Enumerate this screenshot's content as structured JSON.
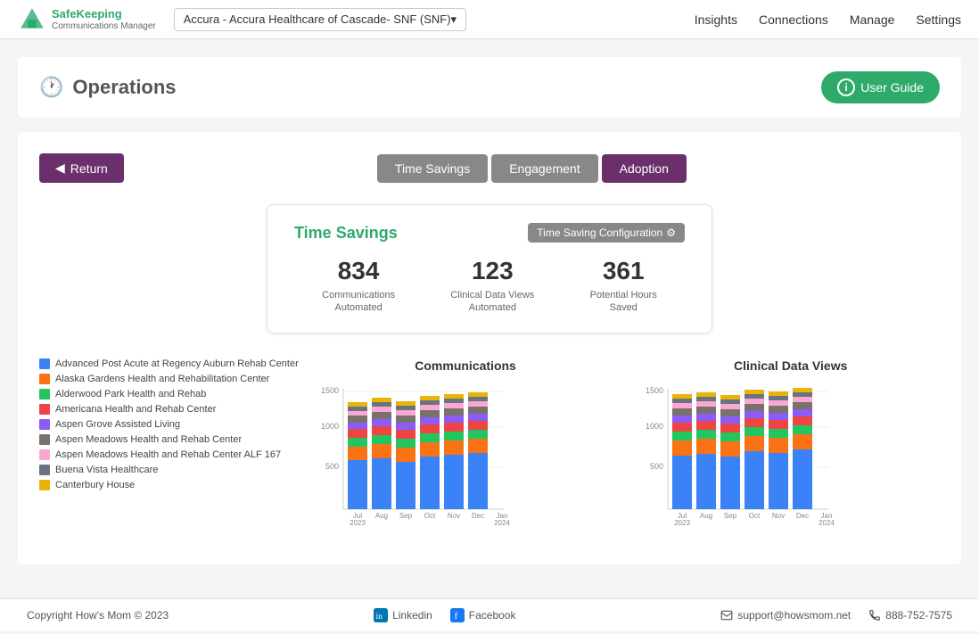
{
  "header": {
    "logo_line1": "Safe",
    "logo_line2": "Keeping",
    "logo_tagline": "Communications Manager",
    "org_select_label": "Accura - Accura Healthcare of Cascade- SNF (SNF)",
    "nav": [
      "Insights",
      "Connections",
      "Manage",
      "Settings"
    ]
  },
  "page_title": "Operations",
  "user_guide_label": "User Guide",
  "return_label": "Return",
  "tabs": [
    {
      "label": "Time Savings",
      "active": true
    },
    {
      "label": "Engagement",
      "active": false
    },
    {
      "label": "Adoption",
      "active": false
    }
  ],
  "time_savings": {
    "title": "Time Savings",
    "config_label": "Time Saving Configuration",
    "stats": [
      {
        "value": "834",
        "label": "Communications\nAutomated"
      },
      {
        "value": "123",
        "label": "Clinical Data Views\nAutomated"
      },
      {
        "value": "361",
        "label": "Potential Hours\nSaved"
      }
    ]
  },
  "charts": {
    "communications_title": "Communications",
    "clinical_title": "Clinical Data Views",
    "x_labels": [
      "Jul\n2023",
      "Aug",
      "Sep",
      "Oct",
      "Nov",
      "Dec",
      "Jan\n2024"
    ]
  },
  "legend": [
    {
      "color": "#3b82f6",
      "label": "Advanced Post Acute at Regency Auburn Rehab Center"
    },
    {
      "color": "#f97316",
      "label": "Alaska Gardens Health and Rehabilitation Center"
    },
    {
      "color": "#22c55e",
      "label": "Alderwood Park Health and Rehab"
    },
    {
      "color": "#ef4444",
      "label": "Americana Health and Rehab Center"
    },
    {
      "color": "#8b5cf6",
      "label": "Aspen Grove Assisted Living"
    },
    {
      "color": "#78716c",
      "label": "Aspen Meadows Health and Rehab Center"
    },
    {
      "color": "#f9a8d4",
      "label": "Aspen Meadows Health and Rehab Center ALF 167"
    },
    {
      "color": "#6b7280",
      "label": "Buena Vista Healthcare"
    },
    {
      "color": "#eab308",
      "label": "Canterbury House"
    }
  ],
  "footer": {
    "copyright": "Copyright How's Mom © 2023",
    "linkedin_label": "Linkedin",
    "facebook_label": "Facebook",
    "support_email": "support@howsmom.net",
    "phone": "888-752-7575"
  }
}
